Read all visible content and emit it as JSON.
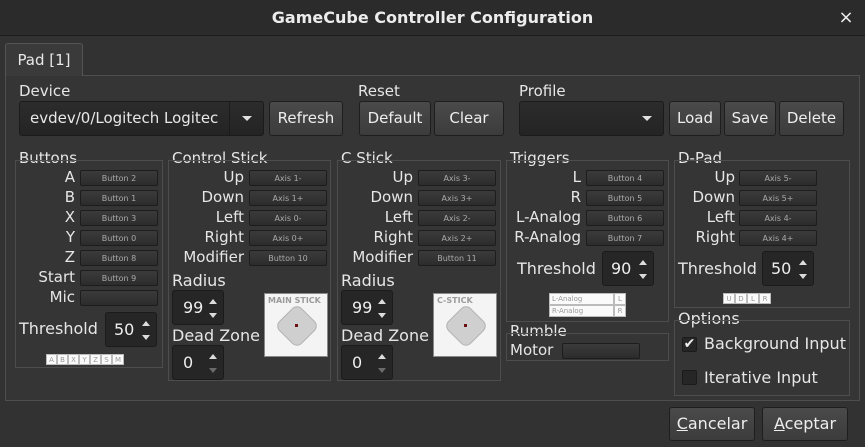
{
  "window": {
    "title": "GameCube Controller Configuration",
    "close_glyph": "×"
  },
  "tab": {
    "label": "Pad [1]"
  },
  "device": {
    "title": "Device",
    "value": "evdev/0/Logitech Logitec",
    "refresh": "Refresh"
  },
  "reset": {
    "title": "Reset",
    "default": "Default",
    "clear": "Clear"
  },
  "profile": {
    "title": "Profile",
    "value": "",
    "load": "Load",
    "save": "Save",
    "delete": "Delete"
  },
  "buttons": {
    "title": "Buttons",
    "rows": [
      {
        "label": "A",
        "map": "Button 2"
      },
      {
        "label": "B",
        "map": "Button 1"
      },
      {
        "label": "X",
        "map": "Button 3"
      },
      {
        "label": "Y",
        "map": "Button 0"
      },
      {
        "label": "Z",
        "map": "Button 8"
      },
      {
        "label": "Start",
        "map": "Button 9"
      },
      {
        "label": "Mic",
        "map": ""
      }
    ],
    "threshold_label": "Threshold",
    "threshold": "50",
    "indicator": [
      "A",
      "B",
      "X",
      "Y",
      "Z",
      "S",
      "M"
    ]
  },
  "control_stick": {
    "title": "Control Stick",
    "rows": [
      {
        "label": "Up",
        "map": "Axis 1-"
      },
      {
        "label": "Down",
        "map": "Axis 1+"
      },
      {
        "label": "Left",
        "map": "Axis 0-"
      },
      {
        "label": "Right",
        "map": "Axis 0+"
      },
      {
        "label": "Modifier",
        "map": "Button 10"
      }
    ],
    "radius_label": "Radius",
    "radius": "99",
    "deadzone_label": "Dead Zone",
    "deadzone": "0",
    "preview_label": "MAIN STICK"
  },
  "c_stick": {
    "title": "C Stick",
    "rows": [
      {
        "label": "Up",
        "map": "Axis 3-"
      },
      {
        "label": "Down",
        "map": "Axis 3+"
      },
      {
        "label": "Left",
        "map": "Axis 2-"
      },
      {
        "label": "Right",
        "map": "Axis 2+"
      },
      {
        "label": "Modifier",
        "map": "Button 11"
      }
    ],
    "radius_label": "Radius",
    "radius": "99",
    "deadzone_label": "Dead Zone",
    "deadzone": "0",
    "preview_label": "C-STICK"
  },
  "triggers": {
    "title": "Triggers",
    "rows": [
      {
        "label": "L",
        "map": "Button 4"
      },
      {
        "label": "R",
        "map": "Button 5"
      },
      {
        "label": "L-Analog",
        "map": "Button 6"
      },
      {
        "label": "R-Analog",
        "map": "Button 7"
      }
    ],
    "threshold_label": "Threshold",
    "threshold": "90",
    "ind_l_analog": "L-Analog",
    "ind_l": "L",
    "ind_r_analog": "R-Analog",
    "ind_r": "R"
  },
  "rumble": {
    "title": "Rumble",
    "motor_label": "Motor",
    "motor_map": ""
  },
  "dpad": {
    "title": "D-Pad",
    "rows": [
      {
        "label": "Up",
        "map": "Axis 5-"
      },
      {
        "label": "Down",
        "map": "Axis 5+"
      },
      {
        "label": "Left",
        "map": "Axis 4-"
      },
      {
        "label": "Right",
        "map": "Axis 4+"
      }
    ],
    "threshold_label": "Threshold",
    "threshold": "50",
    "indicator": [
      "U",
      "D",
      "L",
      "R"
    ]
  },
  "options": {
    "title": "Options",
    "background_input": "Background Input",
    "background_checked": true,
    "iterative_input": "Iterative Input",
    "iterative_checked": false
  },
  "footer": {
    "cancel": "Cancelar",
    "cancel_mnemonic": "C",
    "cancel_rest": "ancelar",
    "accept": "Aceptar",
    "accept_mnemonic": "A",
    "accept_rest": "ceptar"
  }
}
